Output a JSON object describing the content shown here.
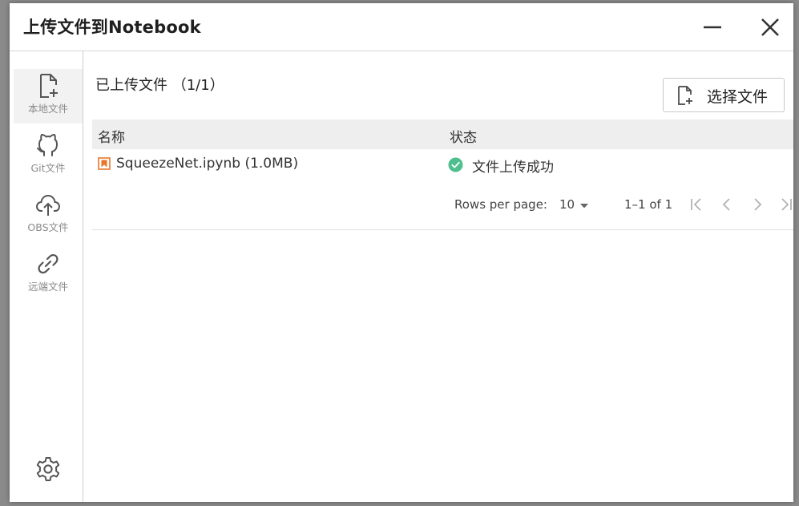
{
  "dialog": {
    "title": "上传文件到Notebook"
  },
  "sidebar": {
    "items": [
      {
        "label": "本地文件",
        "icon": "file-add-icon",
        "active": true
      },
      {
        "label": "Git文件",
        "icon": "github-icon",
        "active": false
      },
      {
        "label": "OBS文件",
        "icon": "cloud-upload-icon",
        "active": false
      },
      {
        "label": "远端文件",
        "icon": "link-icon",
        "active": false
      }
    ],
    "settings_icon": "gear-icon"
  },
  "main": {
    "uploaded_title": "已上传文件 （1/1）",
    "choose_button_label": "选择文件",
    "table": {
      "headers": {
        "name": "名称",
        "status": "状态"
      },
      "rows": [
        {
          "name": "SqueezeNet.ipynb (1.0MB)",
          "status": "文件上传成功"
        }
      ]
    },
    "pagination": {
      "rows_per_page_label": "Rows per page:",
      "rows_per_page_value": "10",
      "range_text": "1–1 of 1"
    }
  },
  "colors": {
    "success": "#4fbf8f",
    "file_icon": "#e8772b",
    "text_muted": "#8a8a8a"
  }
}
